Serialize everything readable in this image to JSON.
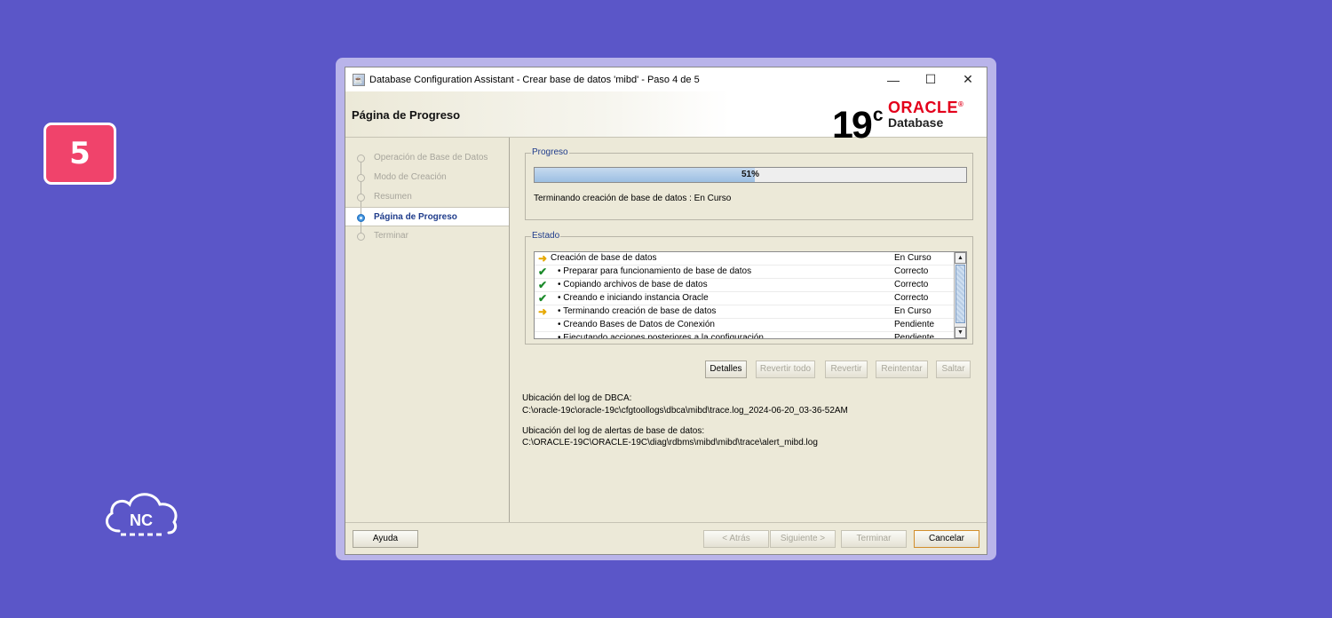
{
  "badge": {
    "number": "5"
  },
  "brand_logo": {
    "text": "NC"
  },
  "window": {
    "title": "Database Configuration Assistant - Crear base de datos 'mibd' - Paso 4 de 5",
    "controls": {
      "minimize": "—",
      "maximize": "☐",
      "close": "✕"
    }
  },
  "header": {
    "page_title": "Página de Progreso",
    "logo_version": "19",
    "logo_version_sup": "c",
    "logo_brand": "ORACLE",
    "logo_brand_mark": "®",
    "logo_product": "Database"
  },
  "sidebar": {
    "steps": [
      {
        "label": "Operación de Base de Datos",
        "active": false
      },
      {
        "label": "Modo de Creación",
        "active": false
      },
      {
        "label": "Resumen",
        "active": false
      },
      {
        "label": "Página de Progreso",
        "active": true
      },
      {
        "label": "Terminar",
        "active": false
      }
    ]
  },
  "progress": {
    "legend": "Progreso",
    "percent": 51,
    "percent_text": "51%",
    "message": "Terminando creación de base de datos : En Curso"
  },
  "status": {
    "legend": "Estado",
    "rows": [
      {
        "icon": "arrow-icon",
        "label": "Creación de base de datos",
        "bullet": false,
        "status": "En Curso"
      },
      {
        "icon": "check-icon",
        "label": "• Preparar para funcionamiento de base de datos",
        "bullet": true,
        "status": "Correcto"
      },
      {
        "icon": "check-icon",
        "label": "• Copiando archivos de base de datos",
        "bullet": true,
        "status": "Correcto"
      },
      {
        "icon": "check-icon",
        "label": "• Creando e iniciando instancia Oracle",
        "bullet": true,
        "status": "Correcto"
      },
      {
        "icon": "arrow-icon",
        "label": "• Terminando creación de base de datos",
        "bullet": true,
        "status": "En Curso"
      },
      {
        "icon": "",
        "label": "• Creando Bases de Datos de Conexión",
        "bullet": true,
        "status": "Pendiente"
      },
      {
        "icon": "",
        "label": "• Ejecutando acciones posteriores a la configuración",
        "bullet": true,
        "status": "Pendiente"
      }
    ]
  },
  "actions": {
    "detalles": "Detalles",
    "revertir_todo": "Revertir todo",
    "revertir": "Revertir",
    "reintentar": "Reintentar",
    "saltar": "Saltar"
  },
  "logs": {
    "dbca_label": "Ubicación del log de DBCA:",
    "dbca_path": "C:\\oracle-19c\\oracle-19c\\cfgtoollogs\\dbca\\mibd\\trace.log_2024-06-20_03-36-52AM",
    "alert_label": "Ubicación del log de alertas de base de datos:",
    "alert_path": "C:\\ORACLE-19C\\ORACLE-19C\\diag\\rdbms\\mibd\\mibd\\trace\\alert_mibd.log"
  },
  "footer": {
    "ayuda": "Ayuda",
    "atras": "< Atrás",
    "siguiente": "Siguiente >",
    "terminar": "Terminar",
    "cancelar": "Cancelar"
  },
  "colors": {
    "background": "#5b56c8",
    "badge": "#f0436b",
    "oracle_red": "#e3001b",
    "accent_blue": "#1f3c8b"
  }
}
